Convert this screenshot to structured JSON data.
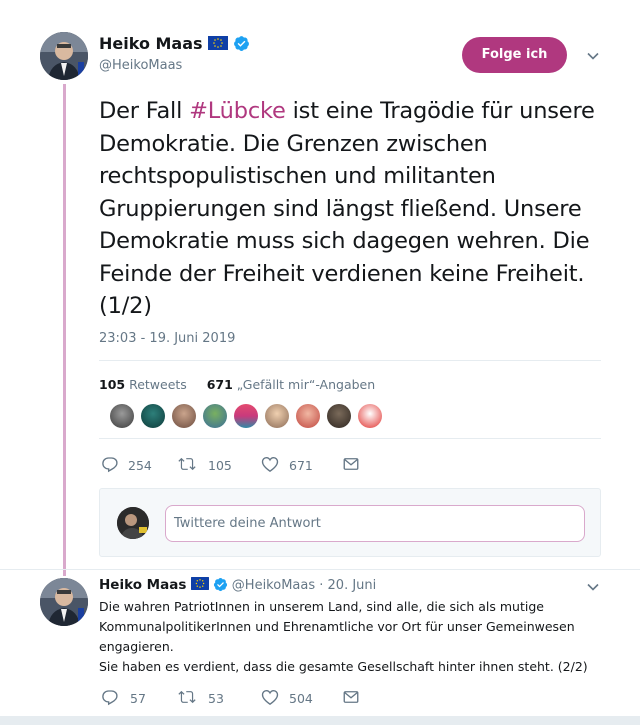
{
  "tweet1": {
    "author_name": "Heiko Maas",
    "author_handle": "@HeikoMaas",
    "follow_label": "Folge ich",
    "text_before_hashtag": "Der Fall ",
    "hashtag": "#Lübcke",
    "text_after_hashtag": " ist eine Tragödie für unsere Demokratie. Die Grenzen zwischen rechtspopulistischen und militanten Gruppierungen sind längst fließend. Unsere Demokratie muss sich dagegen wehren. Die Feinde der Freiheit verdienen keine Freiheit. (1/2)",
    "timestamp": "23:03 - 19. Juni 2019",
    "retweet_count": "105",
    "retweet_label": "Retweets",
    "like_count": "671",
    "like_label": "„Gefällt mir“-Angaben",
    "actions": {
      "reply_count": "254",
      "retweet_count": "105",
      "like_count": "671"
    }
  },
  "reply_box": {
    "placeholder": "Twittere deine Antwort"
  },
  "tweet2": {
    "author_name": "Heiko Maas",
    "author_handle": "@HeikoMaas",
    "separator": " · ",
    "date": "20. Juni",
    "line1": "Die wahren PatriotInnen in unserem Land, sind alle, die sich als mutige KommunalpolitikerInnen und Ehrenamtliche vor Ort für unser Gemeinwesen engagieren.",
    "line2": "Sie haben es verdient, dass die gesamte Gesellschaft hinter ihnen steht. (2/2)",
    "actions": {
      "reply_count": "57",
      "retweet_count": "53",
      "like_count": "504"
    }
  },
  "colors": {
    "accent": "#b0387f",
    "thread_line": "#d9a9cc",
    "secondary_text": "#657786",
    "verified": "#1da1f2",
    "eu_flag": "#0f3fa6"
  },
  "icons": [
    "eu-flag-icon",
    "verified-badge-icon",
    "chevron-down-icon",
    "reply-icon",
    "retweet-icon",
    "like-icon",
    "direct-message-icon"
  ]
}
